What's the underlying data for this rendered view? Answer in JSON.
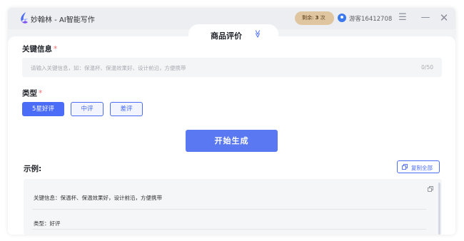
{
  "app": {
    "title": "妙翰林 - AI智能写作"
  },
  "quota": {
    "label": "剩余:",
    "count": "3",
    "unit": "次"
  },
  "user": {
    "name": "游客16412708"
  },
  "tab": {
    "label": "商品评价"
  },
  "form": {
    "keywords_label": "关键信息",
    "keywords_placeholder": "请输入关键信息，如：保温杯、保温效果好、设计前沿，方便携带",
    "keywords_count": "0/50",
    "type_label": "类型",
    "required_mark": "*",
    "types": [
      {
        "label": "5星好评",
        "selected": true
      },
      {
        "label": "中评",
        "selected": false
      },
      {
        "label": "差评",
        "selected": false
      }
    ],
    "generate_label": "开始生成"
  },
  "example": {
    "label": "示例:",
    "copy_all_label": "复制全部",
    "rows": [
      {
        "text": "关键信息：保温杯、保温效果好，设计前沿，方便携带"
      },
      {
        "text": "类型：好评"
      }
    ]
  },
  "colors": {
    "accent": "#4a6cf7",
    "button": "#5a78f2",
    "quota_bg": "#e0c6a0",
    "required": "#f56c6c"
  },
  "icons": [
    "app-logo-icon",
    "user-avatar-icon",
    "menu-icon",
    "minimize-icon",
    "close-icon",
    "chevron-down-double-icon",
    "copy-icon"
  ]
}
